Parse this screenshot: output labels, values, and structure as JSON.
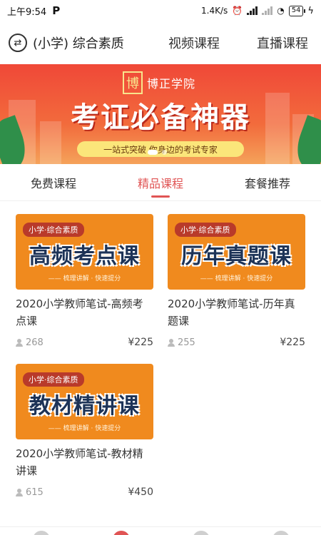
{
  "status_bar": {
    "time": "上午9:54",
    "app_icon": "P",
    "network_speed": "1.4K/s",
    "battery": "54"
  },
  "top_nav": {
    "subject": "(小学) 综合素质",
    "video_courses": "视频课程",
    "live_courses": "直播课程"
  },
  "banner": {
    "brand_seal": "博",
    "brand_name": "博正学院",
    "title": "考证必备神器",
    "tagline": "一站式突破 你身边的考试专家"
  },
  "tabs": [
    {
      "label": "免费课程",
      "active": false
    },
    {
      "label": "精品课程",
      "active": true
    },
    {
      "label": "套餐推荐",
      "active": false
    }
  ],
  "courses": [
    {
      "tag": "小学·综合素质",
      "thumb_title": "高频考点课",
      "thumb_sub": "—— 梳理讲解 · 快速提分",
      "title": "2020小学教师笔试-高频考点课",
      "views": "268",
      "price": "¥225"
    },
    {
      "tag": "小学·综合素质",
      "thumb_title": "历年真题课",
      "thumb_sub": "—— 梳理讲解 · 快速提分",
      "title": "2020小学教师笔试-历年真题课",
      "views": "255",
      "price": "¥225"
    },
    {
      "tag": "小学·综合素质",
      "thumb_title": "教材精讲课",
      "thumb_sub": "—— 梳理讲解 · 快速提分",
      "title": "2020小学教师笔试-教材精讲课",
      "views": "615",
      "price": "¥450"
    }
  ],
  "colors": {
    "accent": "#e05454",
    "thumb_orange": "#f08a1e",
    "thumb_title": "#1d3357",
    "banner_red": "#f04838",
    "pill_yellow": "#fbe67a"
  }
}
